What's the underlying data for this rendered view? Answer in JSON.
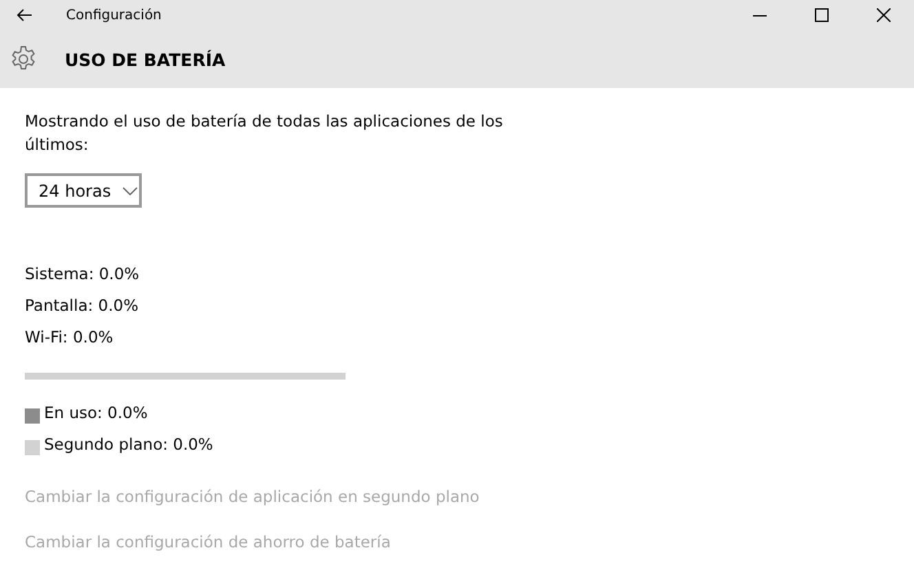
{
  "window": {
    "title": "Configuración"
  },
  "header": {
    "title": "USO DE BATERÍA"
  },
  "description": "Mostrando el uso de batería de todas las aplicaciones de los últimos:",
  "period_dropdown": {
    "value": "24 horas"
  },
  "stats": [
    "Sistema: 0.0%",
    "Pantalla: 0.0%",
    "Wi-Fi: 0.0%"
  ],
  "usage_bar": {
    "level": 0
  },
  "legend": [
    {
      "label": "En uso: 0.0%",
      "color": "#8c8c8c"
    },
    {
      "label": "Segundo plano: 0.0%",
      "color": "#d2d2d2"
    }
  ],
  "links": [
    {
      "label": "Cambiar la configuración de aplicación en segundo plano",
      "disabled": true
    },
    {
      "label": "Cambiar la configuración de ahorro de batería",
      "disabled": true
    }
  ]
}
